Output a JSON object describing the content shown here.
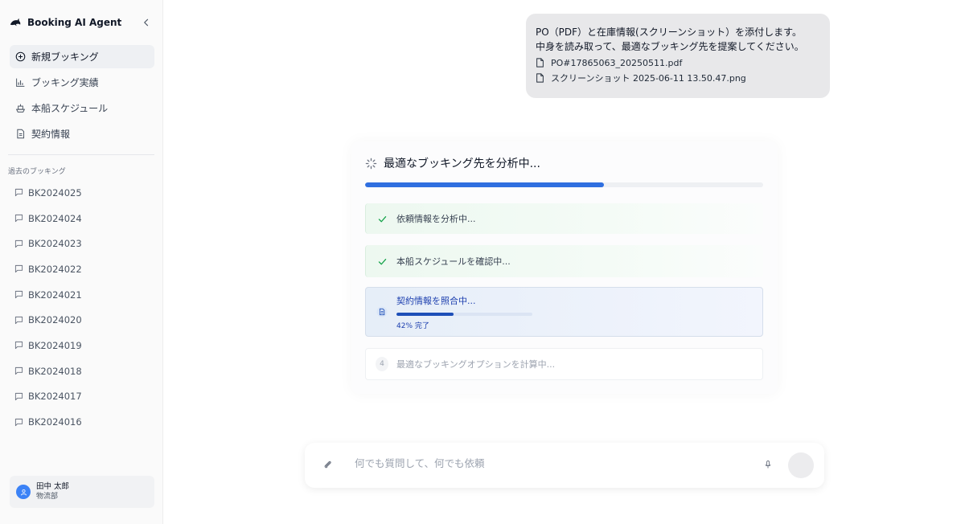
{
  "app": {
    "title": "Booking AI Agent",
    "logo_icon": "dolphin-icon",
    "collapse_icon": "chevron-left-icon"
  },
  "nav": {
    "items": [
      {
        "label": "新規ブッキング",
        "icon": "plus-circle-icon",
        "active": true
      },
      {
        "label": "ブッキング実績",
        "icon": "bar-chart-icon",
        "active": false
      },
      {
        "label": "本船スケジュール",
        "icon": "ship-icon",
        "active": false
      },
      {
        "label": "契約情報",
        "icon": "document-icon",
        "active": false
      }
    ]
  },
  "history": {
    "title": "過去のブッキング",
    "items": [
      "BK2024025",
      "BK2024024",
      "BK2024023",
      "BK2024022",
      "BK2024021",
      "BK2024020",
      "BK2024019",
      "BK2024018",
      "BK2024017",
      "BK2024016"
    ]
  },
  "user": {
    "name": "田中 太郎",
    "department": "物流部"
  },
  "message": {
    "lines": [
      "PO（PDF）と在庫情報(スクリーンショット）を添付します。",
      "中身を読み取って、最適なブッキング先を提案してください。"
    ],
    "attachments": [
      "PO#17865063_20250511.pdf",
      "スクリーンショット 2025-06-11 13.50.47.png"
    ]
  },
  "analysis": {
    "title": "最適なブッキング先を分析中...",
    "progress": 0.6,
    "steps": [
      {
        "label": "依頼情報を分析中...",
        "status": "done"
      },
      {
        "label": "本船スケジュールを確認中...",
        "status": "done"
      },
      {
        "label": "契約情報を照合中...",
        "status": "active",
        "progress": 0.42,
        "progress_text": "42% 完了"
      },
      {
        "label": "最適なブッキングオプションを計算中...",
        "status": "pending",
        "number": "4"
      }
    ]
  },
  "composer": {
    "placeholder": "何でも質問して、何でも依頼"
  },
  "colors": {
    "accent": "#2f6fe0",
    "done_green": "#16a34a",
    "active_blue": "#1e40af"
  }
}
